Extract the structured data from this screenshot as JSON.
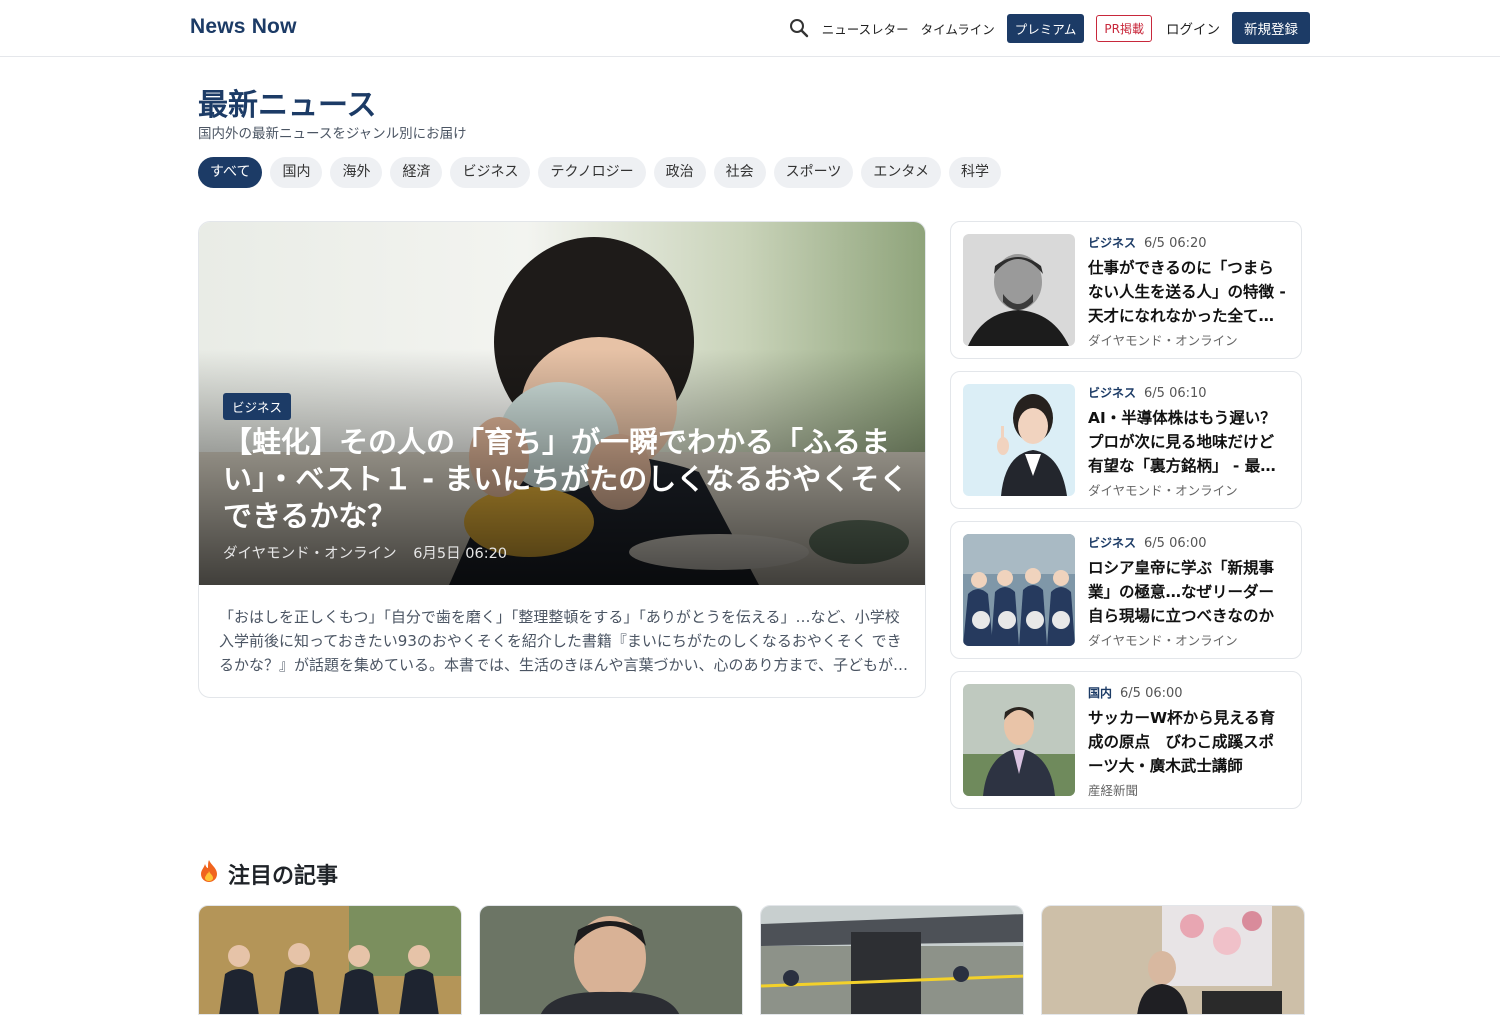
{
  "header": {
    "logo": "News Now",
    "nav": {
      "newsletter": "ニュースレター",
      "timeline": "タイムライン",
      "premium": "プレミアム",
      "pr": "PR掲載",
      "login": "ログイン",
      "register": "新規登録"
    }
  },
  "page": {
    "title": "最新ニュース",
    "subtitle": "国内外の最新ニュースをジャンル別にお届け"
  },
  "categories": [
    "すべて",
    "国内",
    "海外",
    "経済",
    "ビジネス",
    "テクノロジー",
    "政治",
    "社会",
    "スポーツ",
    "エンタメ",
    "科学"
  ],
  "active_category": "すべて",
  "hero": {
    "badge": "ビジネス",
    "title": "【蛙化】その人の「育ち」が一瞬でわかる「ふるまい」・ベスト１ - まいにちがたのしくなるおやくそく できるかな？",
    "source": "ダイヤモンド・オンライン",
    "date": "6月5日 06:20",
    "excerpt": "「おはしを正しくもつ」「自分で歯を磨く」「整理整頓をする」「ありがとうを伝える」…など、小学校入学前後に知っておきたい93のおやくそくを紹介した書籍『まいにちがたのしくなるおやくそく できるかな？』が話題を集めている。本書では、生活のきほんや言葉づかい、心のあり方まで、子どもが身につけたい習慣をわかりやすく解説している。"
  },
  "side": [
    {
      "category": "ビジネス",
      "time": "6/5 06:20",
      "title": "仕事ができるのに「つまらない人生を送る人」の特徴 - 天才になれなかった全ての人へ",
      "source": "ダイヤモンド・オンライン"
    },
    {
      "category": "ビジネス",
      "time": "6/5 06:10",
      "title": "AI・半導体株はもう遅い？プロが次に見る地味だけど有望な「裏方銘柄」 - 最強の投資術",
      "source": "ダイヤモンド・オンライン"
    },
    {
      "category": "ビジネス",
      "time": "6/5 06:00",
      "title": "ロシア皇帝に学ぶ「新規事業」の極意…なぜリーダー自ら現場に立つべきなのか",
      "source": "ダイヤモンド・オンライン"
    },
    {
      "category": "国内",
      "time": "6/5 06:00",
      "title": "サッカーW杯から見える育成の原点　びわこ成蹊スポーツ大・廣木武士講師",
      "source": "産経新聞"
    }
  ],
  "featured": {
    "icon": "fire-icon",
    "title": "注目の記事"
  },
  "colors": {
    "brand": "#1c3b66",
    "pr": "#c8283b",
    "chip_bg": "#eef0f3"
  }
}
